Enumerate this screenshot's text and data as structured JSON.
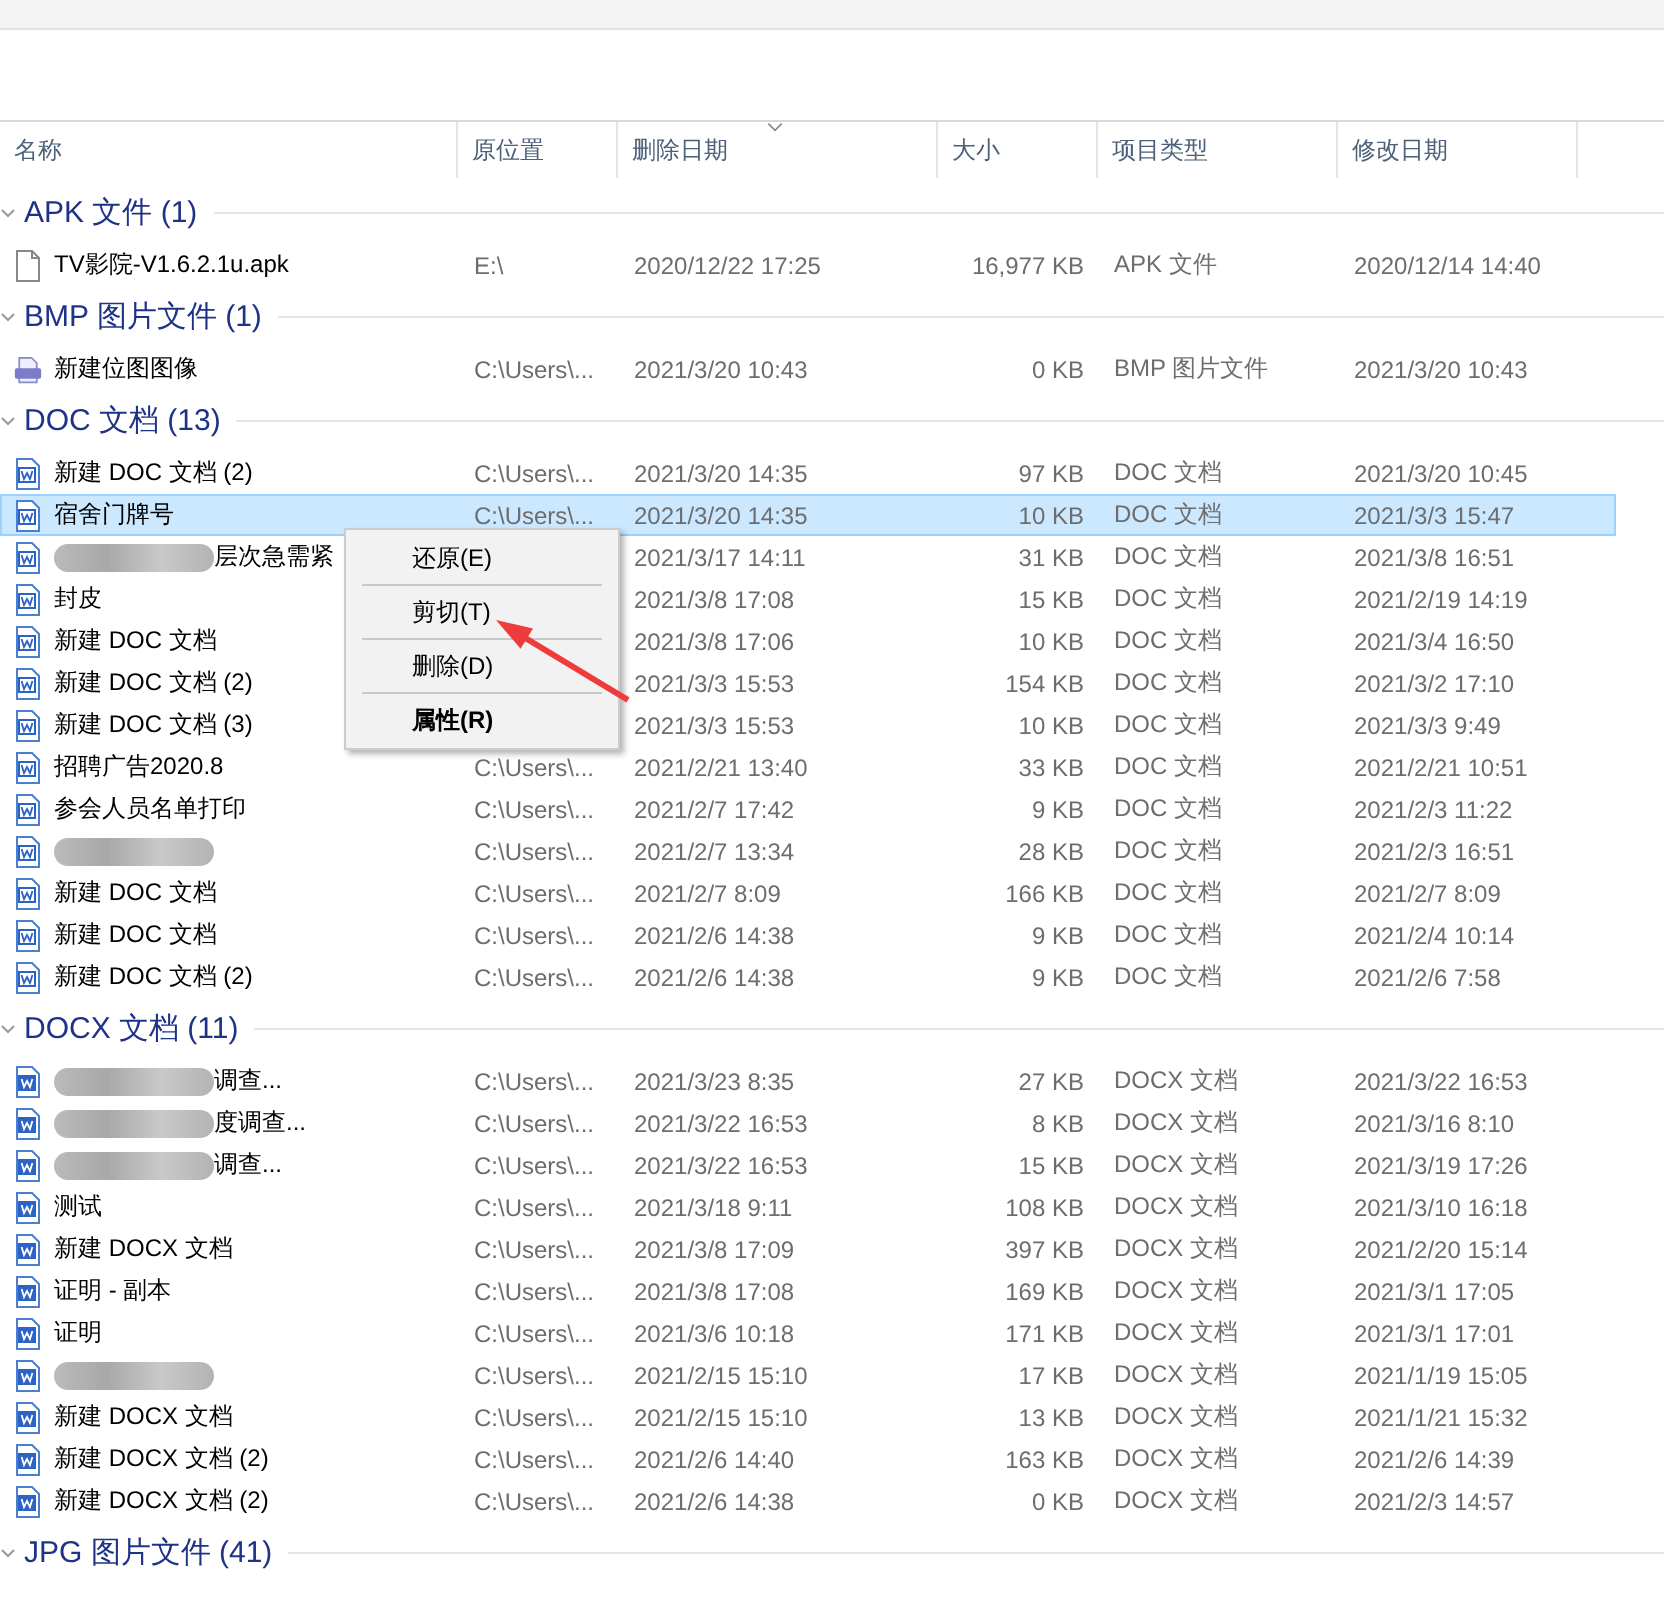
{
  "columns": [
    {
      "label": "名称",
      "sorted": false
    },
    {
      "label": "原位置",
      "sorted": false
    },
    {
      "label": "删除日期",
      "sorted": true
    },
    {
      "label": "大小",
      "sorted": false
    },
    {
      "label": "项目类型",
      "sorted": false
    },
    {
      "label": "修改日期",
      "sorted": false
    }
  ],
  "groups": [
    {
      "title": "APK 文件 (1)",
      "expanded": true,
      "rows": [
        {
          "kind": "file",
          "name": "TV影院-V1.6.2.1u.apk",
          "location": "E:\\",
          "deleted": "2020/12/22 17:25",
          "size": "16,977 KB",
          "type": "APK 文件",
          "modified": "2020/12/14 14:40",
          "selected": false,
          "blurred": false
        }
      ]
    },
    {
      "title": "BMP 图片文件 (1)",
      "expanded": true,
      "rows": [
        {
          "kind": "bmp",
          "name": "新建位图图像",
          "location": "C:\\Users\\...",
          "deleted": "2021/3/20 10:43",
          "size": "0 KB",
          "type": "BMP 图片文件",
          "modified": "2021/3/20 10:43",
          "selected": false,
          "blurred": false
        }
      ]
    },
    {
      "title": "DOC 文档 (13)",
      "expanded": true,
      "rows": [
        {
          "kind": "doc",
          "name": "新建 DOC 文档 (2)",
          "location": "C:\\Users\\...",
          "deleted": "2021/3/20 14:35",
          "size": "97 KB",
          "type": "DOC 文档",
          "modified": "2021/3/20 10:45",
          "selected": false,
          "blurred": false
        },
        {
          "kind": "doc",
          "name": "宿舍门牌号",
          "location": "C:\\Users\\...",
          "deleted": "2021/3/20 14:35",
          "size": "10 KB",
          "type": "DOC 文档",
          "modified": "2021/3/3 15:47",
          "selected": true,
          "blurred": false
        },
        {
          "kind": "doc",
          "name": "层次急需紧",
          "deleted": "2021/3/17 14:11",
          "size": "31 KB",
          "type": "DOC 文档",
          "modified": "2021/3/8 16:51",
          "selected": false,
          "blurred": true
        },
        {
          "kind": "doc",
          "name": "封皮",
          "deleted": "2021/3/8 17:08",
          "size": "15 KB",
          "type": "DOC 文档",
          "modified": "2021/2/19 14:19",
          "selected": false,
          "blurred": false
        },
        {
          "kind": "doc",
          "name": "新建 DOC 文档",
          "deleted": "2021/3/8 17:06",
          "size": "10 KB",
          "type": "DOC 文档",
          "modified": "2021/3/4 16:50",
          "selected": false,
          "blurred": false
        },
        {
          "kind": "doc",
          "name": "新建 DOC 文档 (2)",
          "deleted": "2021/3/3 15:53",
          "size": "154 KB",
          "type": "DOC 文档",
          "modified": "2021/3/2 17:10",
          "selected": false,
          "blurred": false
        },
        {
          "kind": "doc",
          "name": "新建 DOC 文档 (3)",
          "deleted": "2021/3/3 15:53",
          "size": "10 KB",
          "type": "DOC 文档",
          "modified": "2021/3/3 9:49",
          "selected": false,
          "blurred": false
        },
        {
          "kind": "doc",
          "name": "招聘广告2020.8",
          "location": "C:\\Users\\...",
          "deleted": "2021/2/21 13:40",
          "size": "33 KB",
          "type": "DOC 文档",
          "modified": "2021/2/21 10:51",
          "selected": false,
          "blurred": false
        },
        {
          "kind": "doc",
          "name": "参会人员名单打印",
          "location": "C:\\Users\\...",
          "deleted": "2021/2/7 17:42",
          "size": "9 KB",
          "type": "DOC 文档",
          "modified": "2021/2/3 11:22",
          "selected": false,
          "blurred": false
        },
        {
          "kind": "doc",
          "location": "C:\\Users\\...",
          "deleted": "2021/2/7 13:34",
          "size": "28 KB",
          "type": "DOC 文档",
          "modified": "2021/2/3 16:51",
          "selected": false,
          "blurred": true
        },
        {
          "kind": "doc",
          "name": "新建 DOC 文档",
          "location": "C:\\Users\\...",
          "deleted": "2021/2/7 8:09",
          "size": "166 KB",
          "type": "DOC 文档",
          "modified": "2021/2/7 8:09",
          "selected": false,
          "blurred": false
        },
        {
          "kind": "doc",
          "name": "新建 DOC 文档",
          "location": "C:\\Users\\...",
          "deleted": "2021/2/6 14:38",
          "size": "9 KB",
          "type": "DOC 文档",
          "modified": "2021/2/4 10:14",
          "selected": false,
          "blurred": false
        },
        {
          "kind": "doc",
          "name": "新建 DOC 文档 (2)",
          "location": "C:\\Users\\...",
          "deleted": "2021/2/6 14:38",
          "size": "9 KB",
          "type": "DOC 文档",
          "modified": "2021/2/6 7:58",
          "selected": false,
          "blurred": false
        }
      ]
    },
    {
      "title": "DOCX 文档 (11)",
      "expanded": true,
      "rows": [
        {
          "kind": "docx",
          "name": "调查...",
          "location": "C:\\Users\\...",
          "deleted": "2021/3/23 8:35",
          "size": "27 KB",
          "type": "DOCX 文档",
          "modified": "2021/3/22 16:53",
          "selected": false,
          "blurred": true
        },
        {
          "kind": "docx",
          "name": "度调查...",
          "location": "C:\\Users\\...",
          "deleted": "2021/3/22 16:53",
          "size": "8 KB",
          "type": "DOCX 文档",
          "modified": "2021/3/16 8:10",
          "selected": false,
          "blurred": true
        },
        {
          "kind": "docx",
          "name": "调查...",
          "location": "C:\\Users\\...",
          "deleted": "2021/3/22 16:53",
          "size": "15 KB",
          "type": "DOCX 文档",
          "modified": "2021/3/19 17:26",
          "selected": false,
          "blurred": true
        },
        {
          "kind": "docx",
          "name": "测试",
          "location": "C:\\Users\\...",
          "deleted": "2021/3/18 9:11",
          "size": "108 KB",
          "type": "DOCX 文档",
          "modified": "2021/3/10 16:18",
          "selected": false,
          "blurred": false
        },
        {
          "kind": "docx",
          "name": "新建 DOCX 文档",
          "location": "C:\\Users\\...",
          "deleted": "2021/3/8 17:09",
          "size": "397 KB",
          "type": "DOCX 文档",
          "modified": "2021/2/20 15:14",
          "selected": false,
          "blurred": false
        },
        {
          "kind": "docx",
          "name": "证明 - 副本",
          "location": "C:\\Users\\...",
          "deleted": "2021/3/8 17:08",
          "size": "169 KB",
          "type": "DOCX 文档",
          "modified": "2021/3/1 17:05",
          "selected": false,
          "blurred": false
        },
        {
          "kind": "docx",
          "name": "证明",
          "location": "C:\\Users\\...",
          "deleted": "2021/3/6 10:18",
          "size": "171 KB",
          "type": "DOCX 文档",
          "modified": "2021/3/1 17:01",
          "selected": false,
          "blurred": false
        },
        {
          "kind": "docx",
          "location": "C:\\Users\\...",
          "deleted": "2021/2/15 15:10",
          "size": "17 KB",
          "type": "DOCX 文档",
          "modified": "2021/1/19 15:05",
          "selected": false,
          "blurred": true
        },
        {
          "kind": "docx",
          "name": "新建 DOCX 文档",
          "location": "C:\\Users\\...",
          "deleted": "2021/2/15 15:10",
          "size": "13 KB",
          "type": "DOCX 文档",
          "modified": "2021/1/21 15:32",
          "selected": false,
          "blurred": false
        },
        {
          "kind": "docx",
          "name": "新建 DOCX 文档 (2)",
          "location": "C:\\Users\\...",
          "deleted": "2021/2/6 14:40",
          "size": "163 KB",
          "type": "DOCX 文档",
          "modified": "2021/2/6 14:39",
          "selected": false,
          "blurred": false
        },
        {
          "kind": "docx",
          "name": "新建 DOCX 文档 (2)",
          "location": "C:\\Users\\...",
          "deleted": "2021/2/6 14:38",
          "size": "0 KB",
          "type": "DOCX 文档",
          "modified": "2021/2/3 14:57",
          "selected": false,
          "blurred": false
        }
      ]
    },
    {
      "title": "JPG 图片文件 (41)",
      "expanded": true
    }
  ],
  "context_menu": {
    "items": [
      {
        "label": "还原(E)",
        "bold": false
      },
      {
        "label": "剪切(T)",
        "bold": false
      },
      {
        "label": "删除(D)",
        "bold": false
      },
      {
        "label": "属性(R)",
        "bold": true
      }
    ]
  },
  "annotation": {
    "kind": "arrow"
  }
}
